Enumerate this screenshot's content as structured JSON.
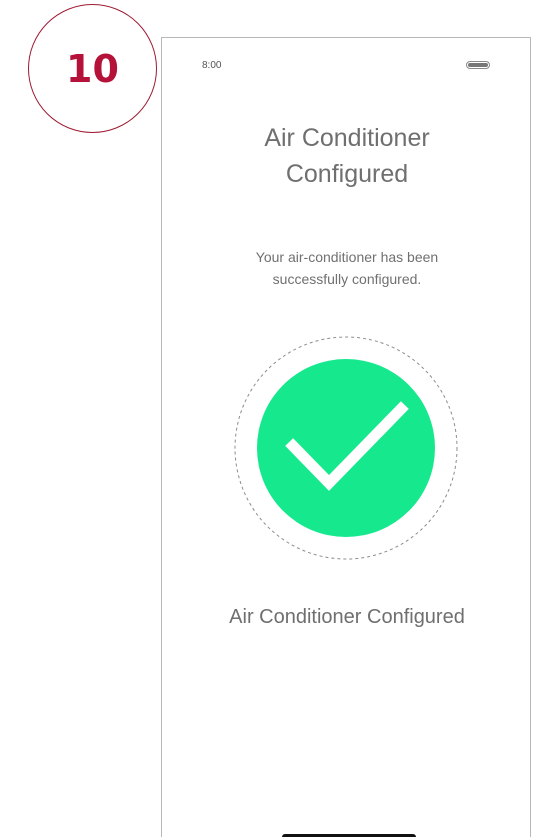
{
  "step": {
    "number": "10",
    "color": "#b5123a"
  },
  "status_bar": {
    "time": "8:00",
    "battery_icon": "battery-icon"
  },
  "screen": {
    "title_line1": "Air Conditioner",
    "title_line2": "Configured",
    "message_line1": "Your air-conditioner has been",
    "message_line2": "successfully configured.",
    "success_icon": "checkmark-icon",
    "success_color": "#16e88e",
    "footer_label": "Air Conditioner Configured"
  }
}
